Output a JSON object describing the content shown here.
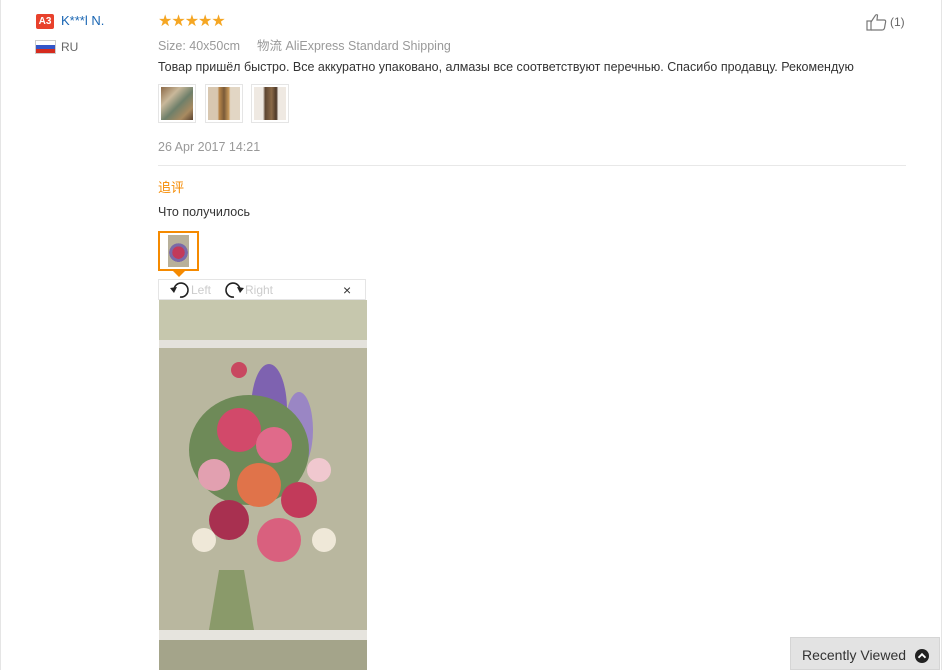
{
  "reviewer": {
    "badge": "A3",
    "name": "K***l N.",
    "country": "RU"
  },
  "review": {
    "rating": "★★★★★",
    "size_label": "Size:",
    "size_value": "40x50cm",
    "shipping_label": "物流",
    "shipping_value": "AliExpress Standard Shipping",
    "text": "Товар пришёл быстро. Все аккуратно упаковано, алмазы все соответствуют перечнью. Спасибо продавцу. Рекомендую",
    "date": "26 Apr 2017 14:21",
    "helpful_count": "(1)"
  },
  "additional_feedback": {
    "label": "追评",
    "text": "Что получилось"
  },
  "image_viewer": {
    "rotate_left": "Left",
    "rotate_right": "Right",
    "close": "×"
  },
  "recently_viewed": {
    "label": "Recently Viewed"
  },
  "colors": {
    "accent_orange": "#f58a00",
    "link_blue": "#1a66b3",
    "star": "#f5a623",
    "badge_red": "#e8412c"
  }
}
